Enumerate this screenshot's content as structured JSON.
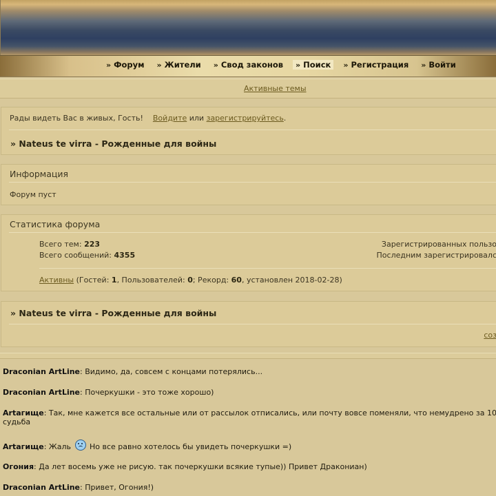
{
  "nav": {
    "items": [
      {
        "label": "Форум"
      },
      {
        "label": "Жители"
      },
      {
        "label": "Свод законов"
      },
      {
        "label": "Поиск"
      },
      {
        "label": "Регистрация"
      },
      {
        "label": "Войти"
      }
    ]
  },
  "active_topics_link": "Активные темы",
  "welcome": {
    "text": "Рады видеть Вас в живых, Гость!",
    "login_link": "Войдите",
    "or": "или",
    "register_link": "зарегистрируйтесь",
    "dot": "."
  },
  "forum_title": "» Nateus te virra - Рожденные для войны",
  "info": {
    "header": "Информация",
    "text": "Форум пуст"
  },
  "stats": {
    "header": "Статистика форума",
    "topics_label": "Всего тем:",
    "topics_value": "223",
    "posts_label": "Всего сообщений:",
    "posts_value": "4355",
    "registered_label": "Зарегистрированных пользо",
    "last_registered_label": "Последним зарегистрировалс",
    "online_link": "Активны",
    "online_p1": "(Гостей:",
    "guests": "1",
    "online_p2": ", Пользователей:",
    "users": "0",
    "online_p3": "; Рекорд:",
    "record": "60",
    "online_p4": ", установлен 2018-02-28)"
  },
  "chat_title": "» Nateus te virra - Рожденные для войны",
  "chat_create_link": "соз",
  "chat_messages": [
    {
      "author": "Draconian ArtLine",
      "text": ": Видимо, да, совсем с концами потерялись..."
    },
    {
      "author": "Draconian ArtLine",
      "text": ": Почеркушки - это тоже хорошо)"
    },
    {
      "author": "Artaгище",
      "text": ": Так, мне кажется все остальные или от рассылок отписались, или почту вовсе поменяли, что немудрено за 10",
      "text2": "судьба"
    },
    {
      "author": "Artaгище",
      "text": ": Жаль",
      "text_after": "Но все равно хотелось бы увидеть почеркушки =)"
    },
    {
      "author": "Огония",
      "text": ": Да лет восемь уже не рисую. так почеркушки всякие тупые)) Привет Дракониан)"
    },
    {
      "author": "Draconian ArtLine",
      "text": ": Привет, Огония!)"
    }
  ]
}
